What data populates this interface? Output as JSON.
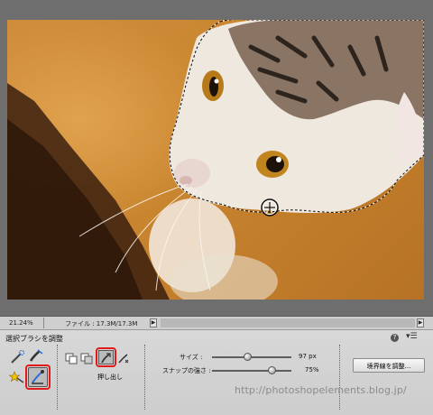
{
  "status": {
    "zoom": "21.24%",
    "file_info": "ファイル : 17.3M/17.3M",
    "arrow_left": "▶",
    "arrow_right": "▶"
  },
  "options": {
    "title": "選択ブラシを調整",
    "help": "?",
    "menu": "▾☰",
    "mode_label": "押し出し",
    "size_label": "サイズ :",
    "size_value": "97 px",
    "size_level": 0.45,
    "snap_label": "スナップの強さ :",
    "snap_value": "75%",
    "snap_level": 0.75,
    "refine_edge_button": "境界線を調整..."
  },
  "watermark": "http://photoshopelements.blog.jp/",
  "colors": {
    "highlight": "#e21a1a",
    "background_orange": "#c9852f"
  }
}
